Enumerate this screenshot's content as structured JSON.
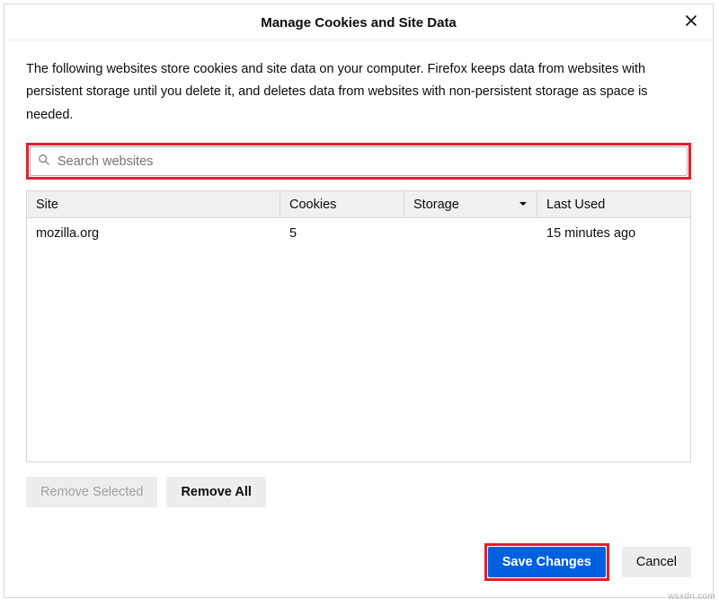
{
  "dialog": {
    "title": "Manage Cookies and Site Data",
    "description": "The following websites store cookies and site data on your computer. Firefox keeps data from websites with persistent storage until you delete it, and deletes data from websites with non-persistent storage as space is needed."
  },
  "search": {
    "placeholder": "Search websites",
    "value": ""
  },
  "columns": {
    "site": "Site",
    "cookies": "Cookies",
    "storage": "Storage",
    "last_used": "Last Used"
  },
  "rows": [
    {
      "site": "mozilla.org",
      "cookies": "5",
      "storage": "",
      "last_used": "15 minutes ago"
    }
  ],
  "buttons": {
    "remove_selected": "Remove Selected",
    "remove_all": "Remove All",
    "save_changes": "Save Changes",
    "cancel": "Cancel"
  },
  "watermark": "wsxdn.com"
}
